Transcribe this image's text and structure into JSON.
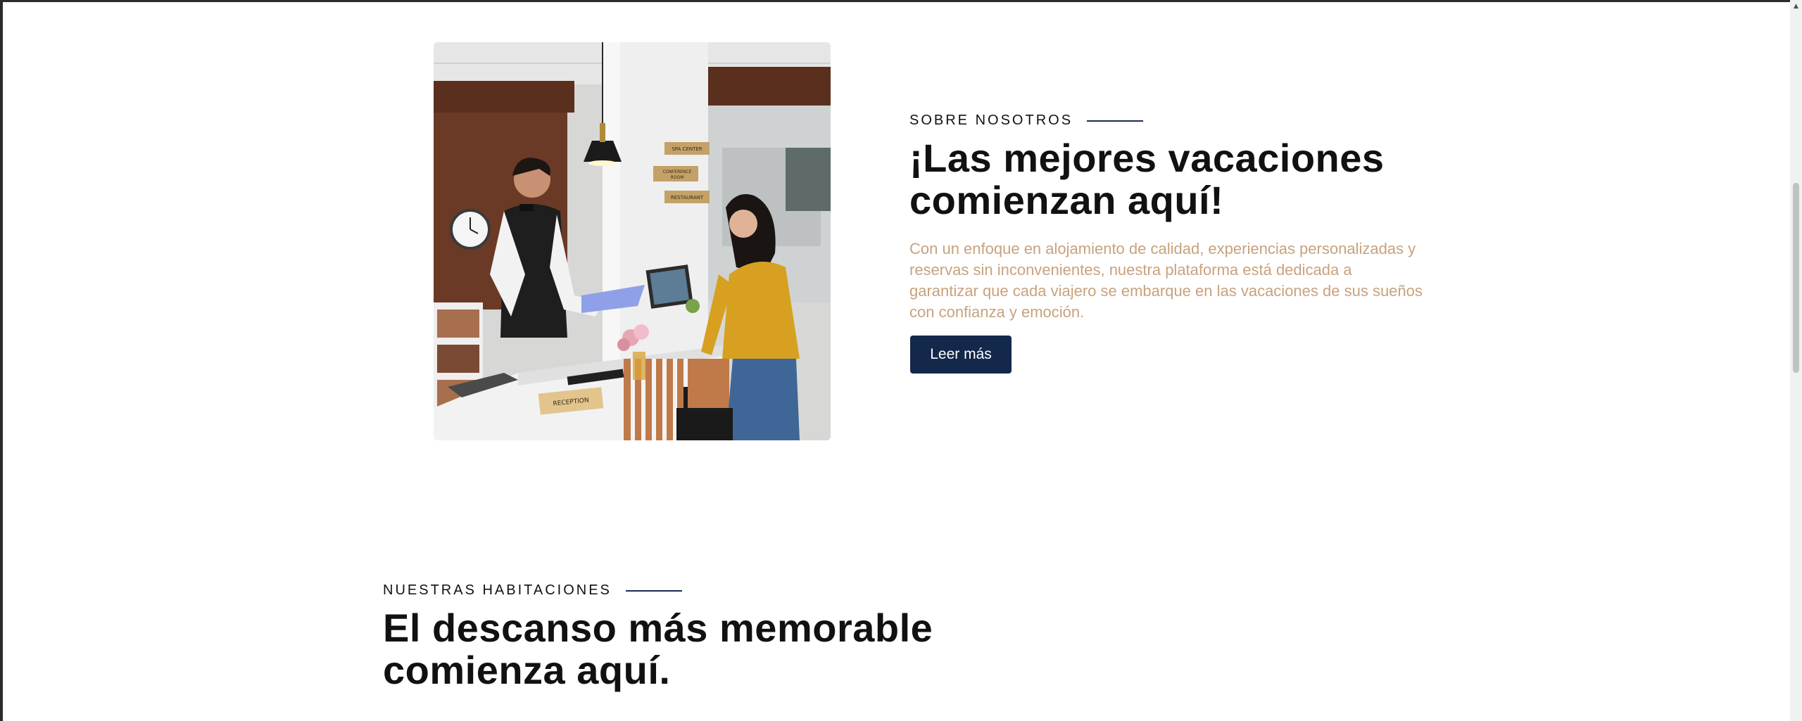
{
  "about": {
    "eyebrow": "SOBRE NOSOTROS",
    "title_line1": "¡Las mejores vacaciones",
    "title_line2": "comienzan aquí!",
    "body": "Con un enfoque en alojamiento de calidad, experiencias personalizadas y reservas sin inconvenientes, nuestra plataforma está dedicada a garantizar que cada viajero se embarque en las vacaciones de sus sueños con confianza y emoción.",
    "button_label": "Leer más",
    "photo": {
      "signs": [
        "SPA CENTER",
        "CONFERENCE",
        "ROOM",
        "RESTAURANT"
      ],
      "desk_sign": "RECEPTION"
    }
  },
  "rooms": {
    "eyebrow": "NUESTRAS HABITACIONES",
    "title_line1": "El descanso más memorable",
    "title_line2": "comienza aquí."
  },
  "colors": {
    "accent": "#13284b",
    "body_text": "#c8a27e",
    "heading": "#111111"
  }
}
